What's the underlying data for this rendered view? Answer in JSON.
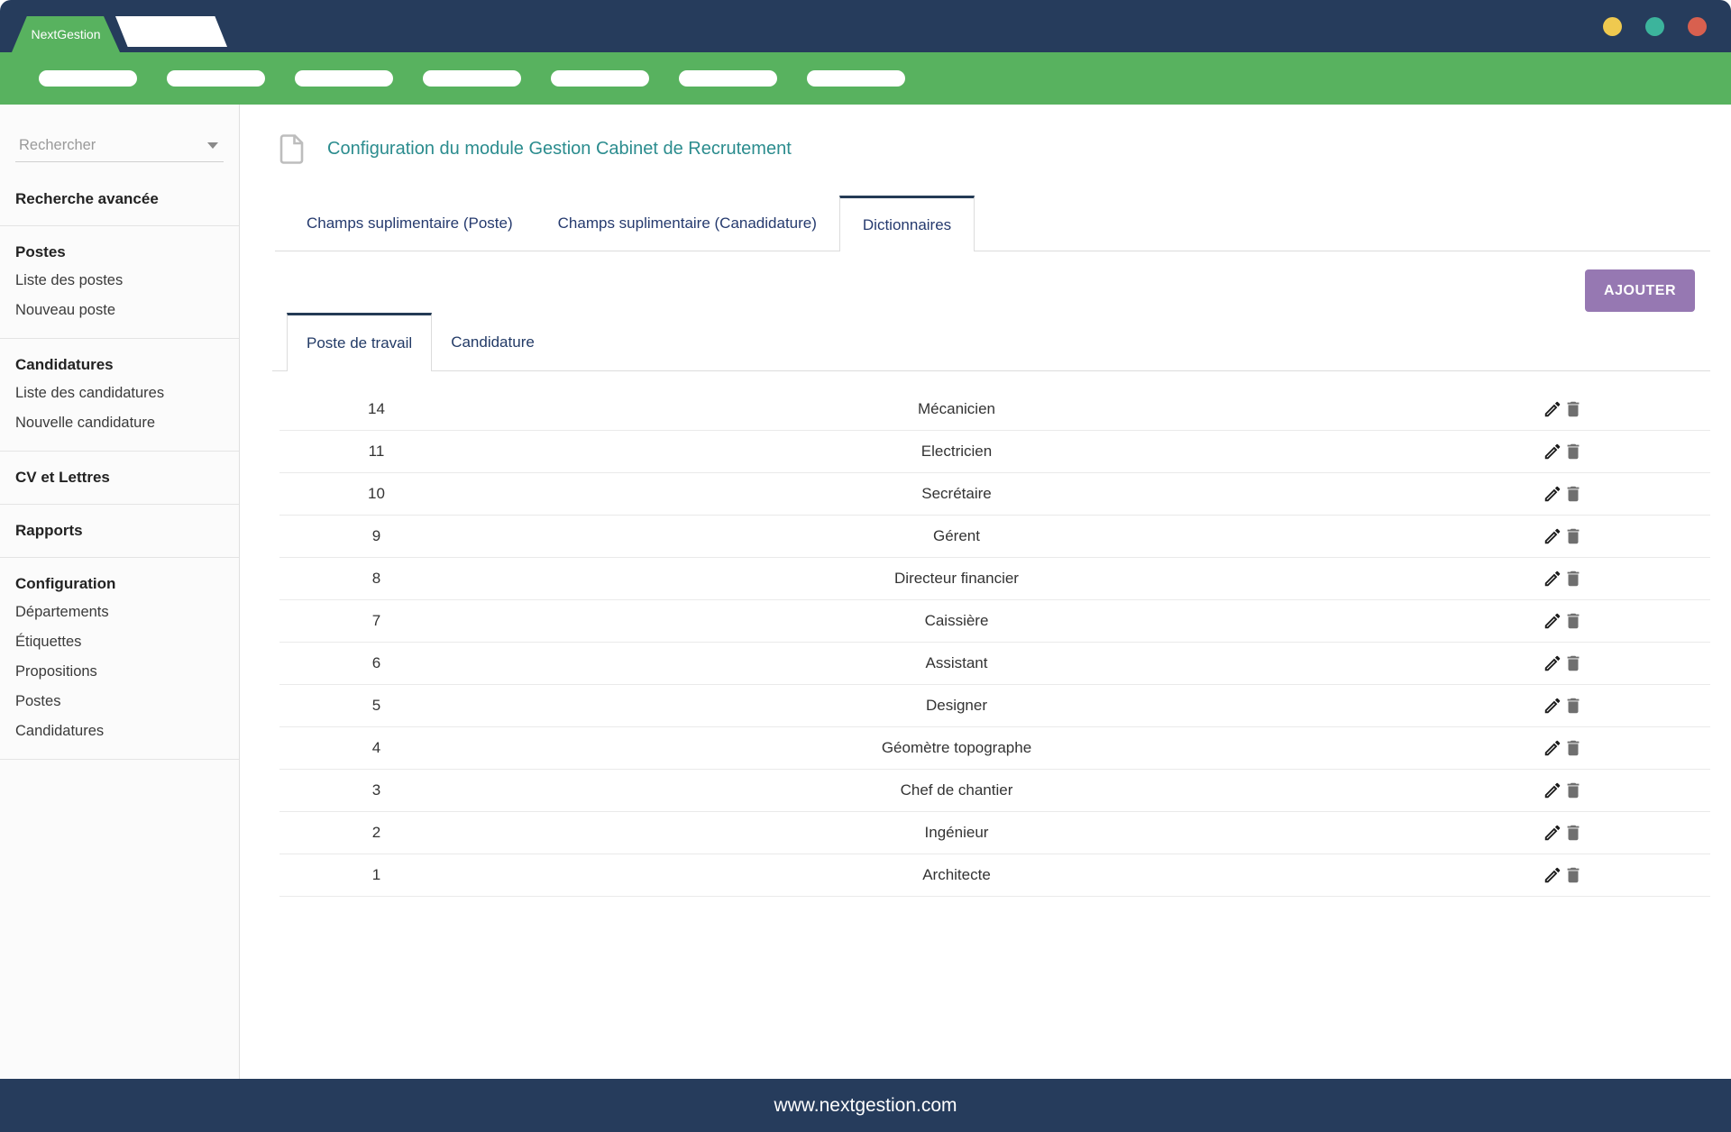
{
  "header": {
    "brand": "NextGestion",
    "window_controls": [
      {
        "name": "minimize",
        "color": "#EFC94F"
      },
      {
        "name": "maximize",
        "color": "#3CB49C"
      },
      {
        "name": "close",
        "color": "#D8604F"
      }
    ]
  },
  "nav": {
    "placeholders": 7
  },
  "sidebar": {
    "search_placeholder": "Rechercher",
    "sections": [
      {
        "header": "Recherche avancée",
        "items": []
      },
      {
        "header": "Postes",
        "items": [
          "Liste des postes",
          "Nouveau poste"
        ]
      },
      {
        "header": "Candidatures",
        "items": [
          "Liste des candidatures",
          "Nouvelle candidature"
        ]
      },
      {
        "header": "CV et Lettres",
        "items": []
      },
      {
        "header": "Rapports",
        "items": []
      },
      {
        "header": "Configuration",
        "items": [
          "Départements",
          "Étiquettes",
          "Propositions",
          "Postes",
          "Candidatures"
        ]
      }
    ]
  },
  "main": {
    "page_title": "Configuration du module Gestion Cabinet de Recrutement",
    "tabs": [
      {
        "label": "Champs suplimentaire (Poste)",
        "active": false
      },
      {
        "label": "Champs suplimentaire (Canadidature)",
        "active": false
      },
      {
        "label": "Dictionnaires",
        "active": true
      }
    ],
    "add_button": "AJOUTER",
    "subtabs": [
      {
        "label": "Poste de travail",
        "active": true
      },
      {
        "label": "Candidature",
        "active": false
      }
    ],
    "dictionary_table": {
      "row_actions": [
        "edit",
        "delete"
      ],
      "rows": [
        {
          "id": "14",
          "label": "Mécanicien"
        },
        {
          "id": "11",
          "label": "Electricien"
        },
        {
          "id": "10",
          "label": "Secrétaire"
        },
        {
          "id": "9",
          "label": "Gérent"
        },
        {
          "id": "8",
          "label": "Directeur financier"
        },
        {
          "id": "7",
          "label": "Caissière"
        },
        {
          "id": "6",
          "label": "Assistant"
        },
        {
          "id": "5",
          "label": "Designer"
        },
        {
          "id": "4",
          "label": "Géomètre topographe"
        },
        {
          "id": "3",
          "label": "Chef de chantier"
        },
        {
          "id": "2",
          "label": "Ingénieur"
        },
        {
          "id": "1",
          "label": "Architecte"
        }
      ]
    }
  },
  "footer": {
    "url": "www.nextgestion.com"
  },
  "colors": {
    "navy": "#263C5C",
    "green": "#58B25F",
    "title_teal": "#2B8C8E",
    "button_purple": "#9678B2",
    "tab_text": "#253A6E"
  }
}
